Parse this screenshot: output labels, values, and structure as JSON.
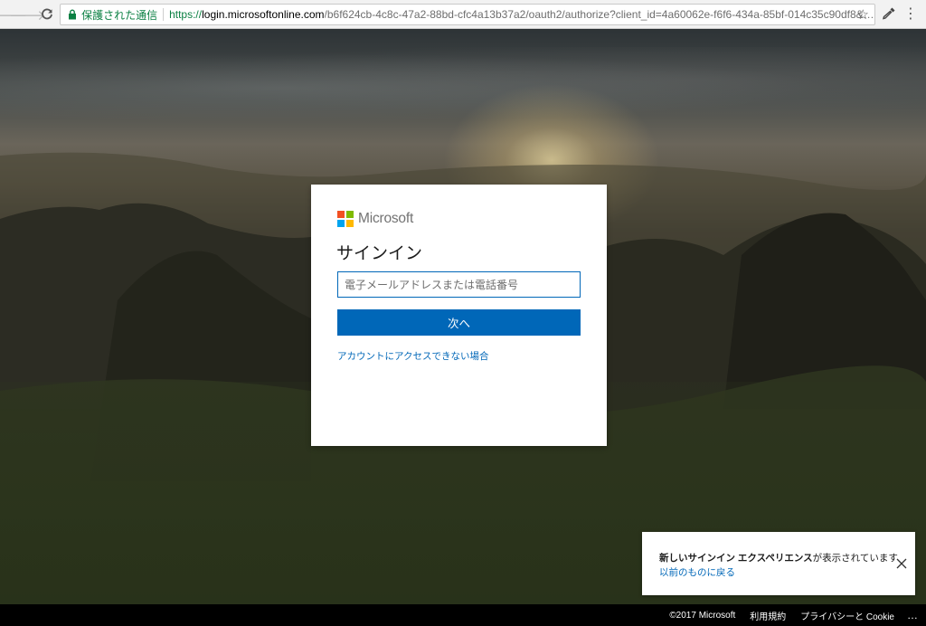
{
  "browser": {
    "secure_label": "保護された通信",
    "url_scheme": "https://",
    "url_host": "login.microsoftonline.com",
    "url_rest": "/b6f624cb-4c8c-47a2-88bd-cfc4a13b37a2/oauth2/authorize?client_id=4a60062e-f6f6-434a-85bf-014c35c90df8&respons..."
  },
  "signin": {
    "brand": "Microsoft",
    "title": "サインイン",
    "email_placeholder": "電子メールアドレスまたは電話番号",
    "next_label": "次へ",
    "cant_access_label": "アカウントにアクセスできない場合",
    "logo_colors": [
      "#f25022",
      "#7fba00",
      "#00a4ef",
      "#ffb900"
    ]
  },
  "notice": {
    "highlight": "新しいサインイン エクスペリエンス",
    "message_suffix": "が表示されています",
    "revert_link": "以前のものに戻る"
  },
  "footer": {
    "copyright": "©2017 Microsoft",
    "terms": "利用規約",
    "privacy": "プライバシーと Cookie",
    "more": "…"
  },
  "colors": {
    "accent": "#0067b8",
    "secure_green": "#0b8043"
  }
}
